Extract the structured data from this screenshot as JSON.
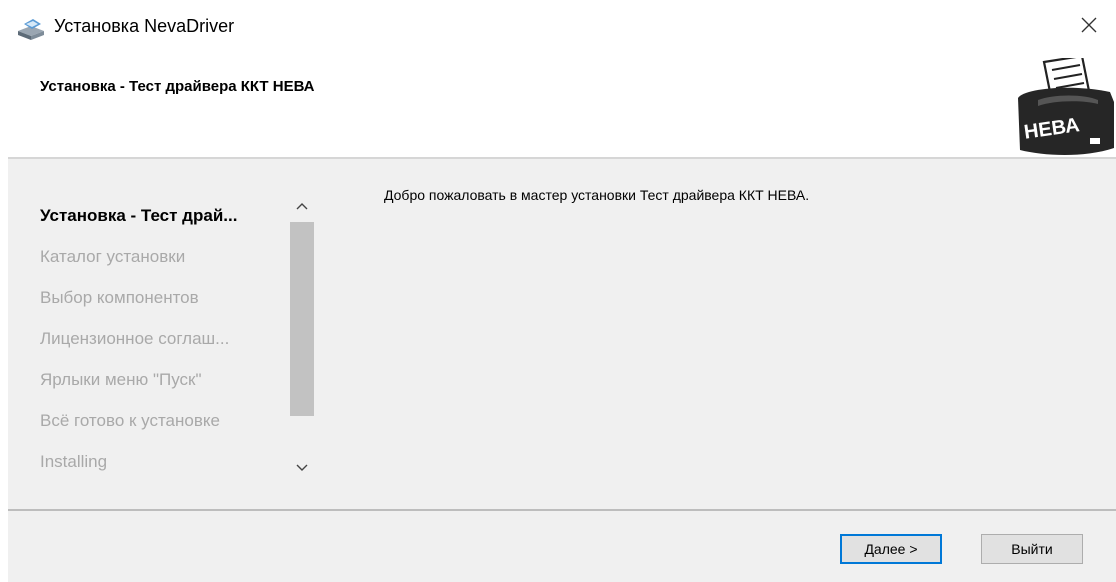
{
  "window": {
    "title": "Установка NevaDriver"
  },
  "header": {
    "title": "Установка - Тест драйвера ККТ НЕВА",
    "logo_text": "НЕВА"
  },
  "steps": [
    {
      "label": "Установка - Тест драй...",
      "active": true
    },
    {
      "label": "Каталог установки",
      "active": false
    },
    {
      "label": "Выбор компонентов",
      "active": false
    },
    {
      "label": "Лицензионное соглаш...",
      "active": false
    },
    {
      "label": "Ярлыки меню \"Пуск\"",
      "active": false
    },
    {
      "label": "Всё готово к установке",
      "active": false
    },
    {
      "label": "Installing",
      "active": false
    }
  ],
  "main": {
    "welcome_text": "Добро пожаловать в мастер установки Тест драйвера ККТ НЕВА."
  },
  "footer": {
    "next_label": "Далее >",
    "exit_label": "Выйти"
  },
  "colors": {
    "accent": "#0078d7",
    "panel_bg": "#f0f0f0",
    "inactive_text": "#a9a9a9"
  }
}
